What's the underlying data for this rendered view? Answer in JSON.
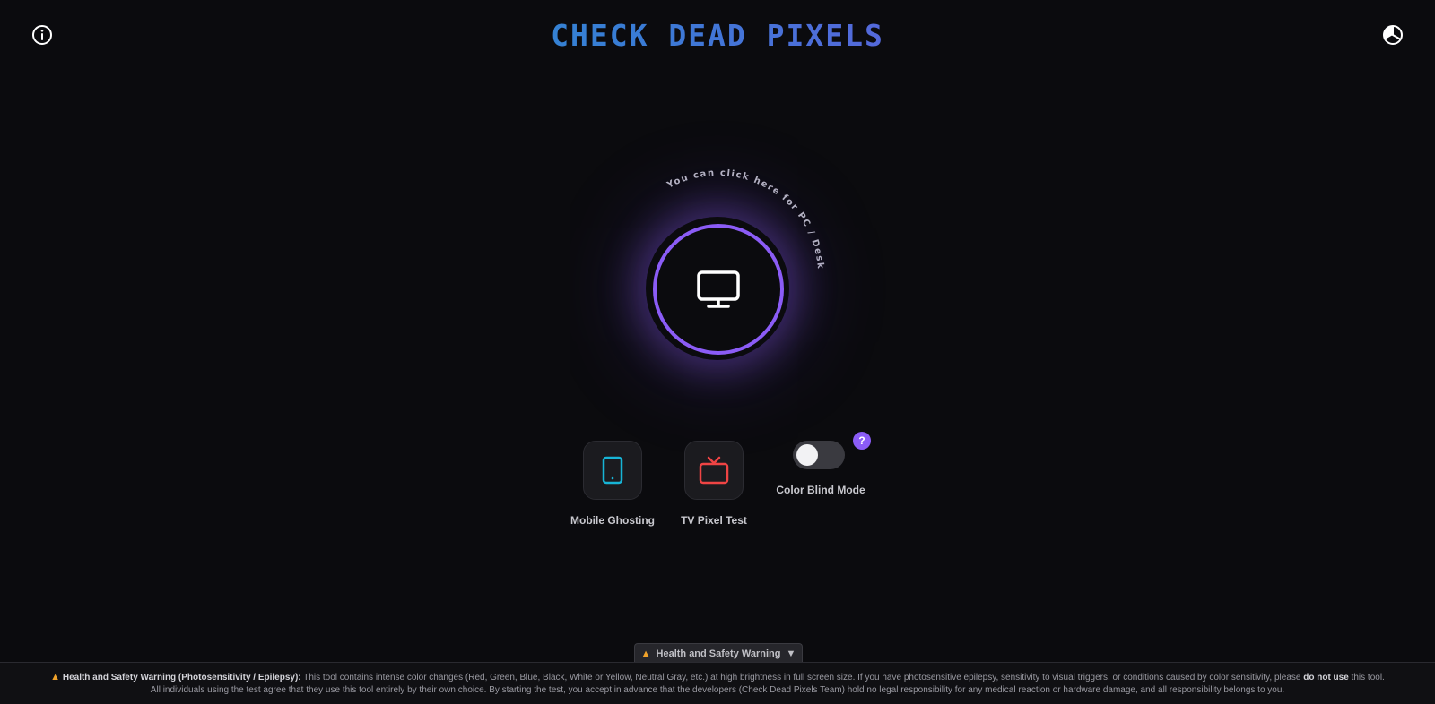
{
  "header": {
    "title": "CHECK DEAD PIXELS",
    "info_icon": "info-icon",
    "theme_icon": "contrast-icon"
  },
  "desktop": {
    "curved_hint": "You can click here for PC / Desktop",
    "icon": "monitor-icon",
    "accent_color": "#8b5cf6"
  },
  "options": {
    "mobile": {
      "label": "Mobile Ghosting",
      "icon": "tablet-icon",
      "color": "#17b4d6"
    },
    "tv": {
      "label": "TV Pixel Test",
      "icon": "tv-icon",
      "color": "#ef4444"
    }
  },
  "color_blind": {
    "label": "Color Blind Mode",
    "enabled": false,
    "help_label": "?"
  },
  "warning": {
    "tab_label": "Health and Safety Warning",
    "tab_chevron": "▼",
    "heading": "Health and Safety Warning (Photosensitivity / Epilepsy):",
    "text_1": "This tool contains intense color changes (Red, Green, Blue, Black, White or Yellow, Neutral Gray, etc.) at high brightness in full screen size. If you have photosensitive epilepsy, sensitivity to visual triggers, or conditions caused by color sensitivity, please",
    "emphasis": "do not use",
    "text_2": "this tool.",
    "line_2": "All individuals using the test agree that they use this tool entirely by their own choice. By starting the test, you accept in advance that the developers (Check Dead Pixels Team) hold no legal responsibility for any medical reaction or hardware damage, and all responsibility belongs to you."
  }
}
